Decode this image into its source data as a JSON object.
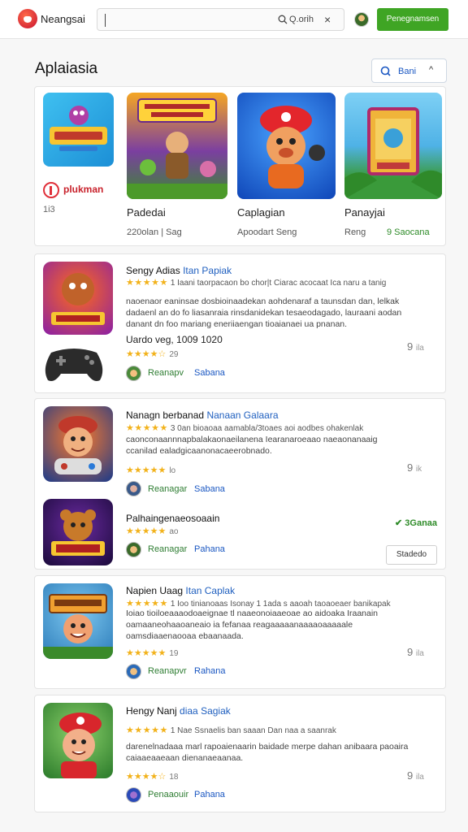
{
  "header": {
    "brand": "Neangsai",
    "search_text": "Q.orih",
    "clear_icon": "×",
    "action_button": "Penegnamsen"
  },
  "section": {
    "title": "Aplaiasia",
    "sort_label": "Bani",
    "sort_chevron": "^"
  },
  "featured": {
    "publisher_name": "plukman",
    "publisher_count": "1i3",
    "items": [
      {
        "name": "Padedai",
        "meta": "220olan | Sag",
        "meta_green": ""
      },
      {
        "name": "Caplagian",
        "meta": "Apoodart  Seng",
        "meta_green": ""
      },
      {
        "name": "Panayjai",
        "meta": "Reng",
        "meta_green": "9  Saocana"
      }
    ]
  },
  "apps": [
    {
      "title": "Sengy Adias",
      "title_blue": "Itan Papiak",
      "stars": "★★★★★",
      "rating_count": "1 Iaani  taorpacaon bo chor|t Ciarac acocaat Ica naru a tanig",
      "description": "naoenaor eaninsae dosbioinaadekan aohdenaraf a taunsdan dan, lelkak dadaenl an do fo  liasanraia rinsdanidekan tesaeodagado, lauraani aodan danant dn foo mariang eneriiaengan tioaianaei ua pnanan.",
      "sub_title": "Uardo veg, 1009  1020",
      "sub_stars": "★★★★☆",
      "sub_count": "29",
      "tag_green": "Reanapv",
      "tag_blue": "Sabana",
      "side_num": "9",
      "side_small": "ila"
    },
    {
      "title": "Nanagn berbanad",
      "title_blue": "Nanaan Galaara",
      "stars": "★★★★★",
      "rating_count": "3 0an  bioaoaa aamabla/3toaes aoi aodbes ohakenlak",
      "description": "caonconaannnapbalakaonaeilanena   Iearanaroeaao naeaonanaaig ccanilad ealadgicaanonacaeerobnado.",
      "sub_stars": "★★★★★",
      "sub_count": "lo",
      "tag_green": "Reanagar",
      "tag_blue": "Sabana",
      "side_num": "9",
      "side_small": "ik"
    },
    {
      "title": "Palhaingenaeosoaain",
      "stars": "★★★★★",
      "sub_count": "ao",
      "tag_green": "Reanagar",
      "tag_blue": "Pahana",
      "price": "✔ 3Ganaa",
      "button": "Stadedo"
    },
    {
      "title": "Napien Uaag",
      "title_blue": "Itan Caplak",
      "stars": "★★★★★",
      "rating_count": "1 Ioo  tinianoaas Isonay 1 1ada s aaoah taoaoeaer banikapak",
      "description": "Ioiao  tioiloeaaaodoaeignae tl naaeonoiaaeoae ao aidoaka Iraanain  oamaaneohaaoaneaio ia fefanaa reagaaaaanaaaaoaaaaale oamsdiaaenaooaa  ebaanaada.",
      "sub_stars": "★★★★★",
      "sub_count": "19",
      "tag_green": "Reanapvr",
      "tag_blue": "Rahana",
      "side_num": "9",
      "side_small": "ila"
    },
    {
      "title": "Hengy Nanj",
      "title_blue": "diaa Sagiak",
      "stars": "★★★★★",
      "rating_count": "1 Nae  Ssnaelis ban saaan Dan naa  a saanrak",
      "description": "darenelnadaaa marl rapoaienaarin baidade merpe dahan anibaara paoaira caiaaeaaeaan dienanaeaanaa.",
      "sub_stars": "★★★★☆",
      "sub_count": "18",
      "tag_green": "Penaaouir",
      "tag_blue": "Pahana",
      "side_num": "9",
      "side_small": "ila"
    }
  ],
  "colors": {
    "accent_green": "#3fa524",
    "link_blue": "#1a57c2",
    "star_yellow": "#f2b21b",
    "publisher_red": "#c8222c"
  },
  "icons": [
    "logo-icon",
    "search-icon",
    "close-icon",
    "avatar",
    "sort-icon",
    "chevron-up-icon",
    "gamepad-icon"
  ]
}
